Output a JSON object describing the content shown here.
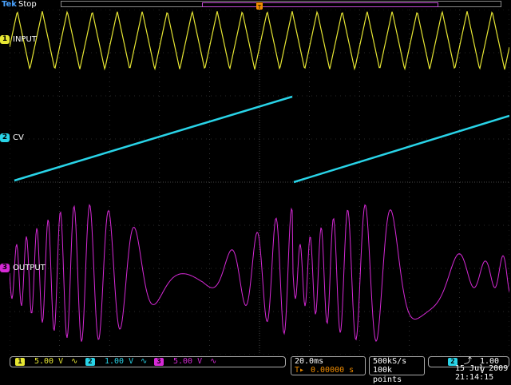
{
  "header": {
    "brand": "Tek",
    "run_state": "Stop"
  },
  "channels": [
    {
      "id": "1",
      "label": "INPUT",
      "color": "#e6e633",
      "scale": "5.00 V"
    },
    {
      "id": "2",
      "label": "CV",
      "color": "#29d4e8",
      "scale": "1.00 V"
    },
    {
      "id": "3",
      "label": "OUTPUT",
      "color": "#d629d6",
      "scale": "5.00 V"
    }
  ],
  "coupling_icon": "bandwidth-limit-icon",
  "timebase": {
    "scale": "20.0ms",
    "trigger_position": "0.00000 s"
  },
  "acquisition": {
    "sample_rate": "500kS/s",
    "record_length": "100k points"
  },
  "trigger": {
    "source": "2",
    "slope_icon": "rising-edge-icon",
    "level": "1.00 V"
  },
  "clock": {
    "date": "15 Jul  2009",
    "time": "21:14:15"
  },
  "colors": {
    "grid": "#555555",
    "ch1": "#e6e633",
    "ch2": "#29d4e8",
    "ch3": "#d629d6",
    "trigger_marker": "#f08c00"
  }
}
